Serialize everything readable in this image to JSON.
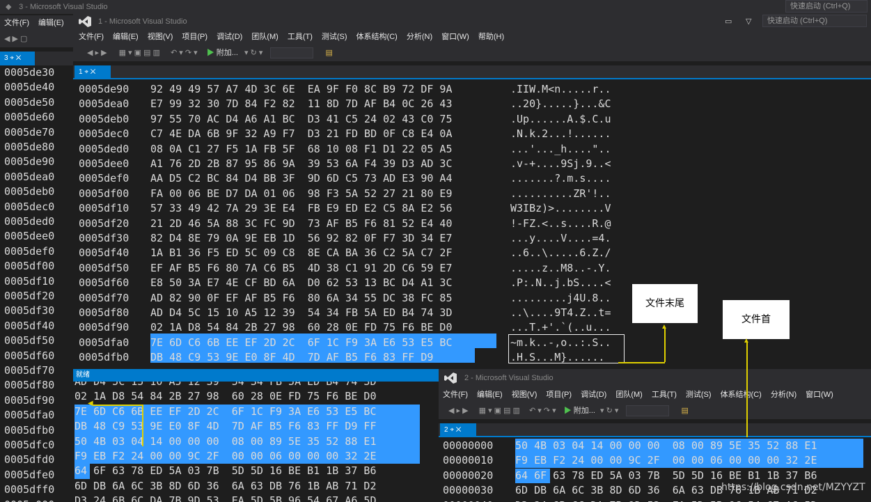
{
  "back_window": {
    "title": "3 - Microsoft Visual Studio",
    "menu": [
      "文件(F)",
      "编辑(E)"
    ],
    "tab": "3",
    "quick_launch": "快速启动 (Ctrl+Q)",
    "offsets": [
      "0005de30",
      "0005de40",
      "0005de50",
      "0005de60",
      "0005de70",
      "0005de80",
      "0005de90",
      "0005dea0",
      "0005deb0",
      "0005dec0",
      "0005ded0",
      "0005dee0",
      "0005def0",
      "0005df00",
      "0005df10",
      "0005df20",
      "0005df30",
      "0005df40",
      "0005df50",
      "0005df60",
      "0005df70",
      "0005df80",
      "0005df90",
      "0005dfa0",
      "0005dfb0",
      "0005dfc0",
      "0005dfd0",
      "0005dfe0",
      "0005dff0",
      "0005e000"
    ],
    "lower_hex": [
      "AD D4 5C 15 10 A5 12 39  54 34 FB 5A ED B4 74 3D",
      "02 1A D8 54 84 2B 27 98  60 28 0E FD 75 F6 BE D0",
      "7E 6D C6 6B EE EF 2D 2C  6F 1C F9 3A E6 53 E5 BC",
      "DB 48 C9 53 9E E0 8F 4D  7D AF B5 F6 83 FF D9 FF",
      "50 4B 03 04 14 00 00 00  08 00 89 5E 35 52 88 E1",
      "F9 EB F2 24 00 00 9C 2F  00 00 06 00 00 00 32 2E",
      "64 6F 63 78 ED 5A 03 7B  5D 5D 16 BE B1 1B 37 B6",
      "6D DB 6A 6C 3B 8D 6D 36  6A 63 DB 76 1B AB 71 D2",
      "D3 24 6B 6C DA 7B 9D 53  EA 5D 5B 96 54 67 A6 5D"
    ]
  },
  "main_window": {
    "title": "1 - Microsoft Visual Studio",
    "menu": [
      "文件(F)",
      "编辑(E)",
      "视图(V)",
      "项目(P)",
      "调试(D)",
      "团队(M)",
      "工具(T)",
      "测试(S)",
      "体系结构(C)",
      "分析(N)",
      "窗口(W)",
      "帮助(H)"
    ],
    "attach": "附加...",
    "tab": "1",
    "quick_launch": "快速启动 (Ctrl+Q)",
    "status": "就绪",
    "rows": [
      {
        "off": "0005de90",
        "hex": "92 49 49 57 A7 4D 3C 6E  EA 9F F0 8C B9 72 DF 9A",
        "asc": ".IIW.M<n.....r.."
      },
      {
        "off": "0005dea0",
        "hex": "E7 99 32 30 7D 84 F2 82  11 8D 7D AF B4 0C 26 43",
        "asc": "..20}.....}...&C"
      },
      {
        "off": "0005deb0",
        "hex": "97 55 70 AC D4 A6 A1 BC  D3 41 C5 24 02 43 C0 75",
        "asc": ".Up......A.$.C.u"
      },
      {
        "off": "0005dec0",
        "hex": "C7 4E DA 6B 9F 32 A9 F7  D3 21 FD BD 0F C8 E4 0A",
        "asc": ".N.k.2...!......"
      },
      {
        "off": "0005ded0",
        "hex": "08 0A C1 27 F5 1A FB 5F  68 10 08 F1 D1 22 05 A5",
        "asc": "...'..._h....\".."
      },
      {
        "off": "0005dee0",
        "hex": "A1 76 2D 2B 87 95 86 9A  39 53 6A F4 39 D3 AD 3C",
        "asc": ".v-+....9Sj.9..<"
      },
      {
        "off": "0005def0",
        "hex": "AA D5 C2 BC 84 D4 BB 3F  9D 6D C5 73 AD E3 90 A4",
        "asc": ".......?.m.s...."
      },
      {
        "off": "0005df00",
        "hex": "FA 00 06 BE D7 DA 01 06  98 F3 5A 52 27 21 80 E9",
        "asc": "..........ZR'!.."
      },
      {
        "off": "0005df10",
        "hex": "57 33 49 42 7A 29 3E E4  FB E9 ED E2 C5 8A E2 56",
        "asc": "W3IBz)>........V"
      },
      {
        "off": "0005df20",
        "hex": "21 2D 46 5A 88 3C FC 9D  73 AF B5 F6 81 52 E4 40",
        "asc": "!-FZ.<..s....R.@"
      },
      {
        "off": "0005df30",
        "hex": "82 D4 8E 79 0A 9E EB 1D  56 92 82 0F F7 3D 34 E7",
        "asc": "...y....V....=4."
      },
      {
        "off": "0005df40",
        "hex": "1A B1 36 F5 ED 5C 09 C8  8E CA BA 36 C2 5A C7 2F",
        "asc": "..6..\\.....6.Z./"
      },
      {
        "off": "0005df50",
        "hex": "EF AF B5 F6 80 7A C6 B5  4D 38 C1 91 2D C6 59 E7",
        "asc": ".....z..M8..-.Y."
      },
      {
        "off": "0005df60",
        "hex": "E8 50 3A E7 4E CF BD 6A  D0 62 53 13 BC D4 A1 3C",
        "asc": ".P:.N..j.bS....<"
      },
      {
        "off": "0005df70",
        "hex": "AD 82 90 0F EF AF B5 F6  80 6A 34 55 DC 38 FC 85",
        "asc": ".........j4U.8.."
      },
      {
        "off": "0005df80",
        "hex": "AD D4 5C 15 10 A5 12 39  54 34 FB 5A ED B4 74 3D",
        "asc": "..\\....9T4.Z..t="
      },
      {
        "off": "0005df90",
        "hex": "02 1A D8 54 84 2B 27 98  60 28 0E FD 75 F6 BE D0",
        "asc": "...T.+'.`(..u..."
      },
      {
        "off": "0005dfa0",
        "hex": "7E 6D C6 6B EE EF 2D 2C  6F 1C F9 3A E6 53 E5 BC",
        "asc": "~m.k..-,o..:.S.."
      },
      {
        "off": "0005dfb0",
        "hex": "DB 48 C9 53 9E E0 8F 4D  7D AF B5 F6 83 FF D9",
        "asc": ".H.S...M}......"
      }
    ]
  },
  "third_window": {
    "title": "2 - Microsoft Visual Studio",
    "menu": [
      "文件(F)",
      "编辑(E)",
      "视图(V)",
      "项目(P)",
      "调试(D)",
      "团队(M)",
      "工具(T)",
      "测试(S)",
      "体系结构(C)",
      "分析(N)",
      "窗口(W)"
    ],
    "attach": "附加...",
    "tab": "2",
    "rows": [
      {
        "off": "00000000",
        "hex": "50 4B 03 04 14 00 00 00  08 00 89 5E 35 52 88 E1"
      },
      {
        "off": "00000010",
        "hex": "F9 EB F2 24 00 00 9C 2F  00 00 06 00 00 00 32 2E"
      },
      {
        "off": "00000020",
        "hex": "64 6F 63 78 ED 5A 03 7B  5D 5D 16 BE B1 1B 37 B6"
      },
      {
        "off": "00000030",
        "hex": "6D DB 6A 6C 3B 8D 6D 36  6A 63 DB 76 1B AB 71 D2"
      },
      {
        "off": "00000040",
        "hex": "D3 24 6B 6C DA 7B 9D 53  EA 5D 5B 96 54 67 A6 5D"
      }
    ]
  },
  "callouts": {
    "file_end": "文件末尾",
    "file_head": "文件首"
  },
  "watermark": "https://blog.csdn.net/MZYYZT"
}
